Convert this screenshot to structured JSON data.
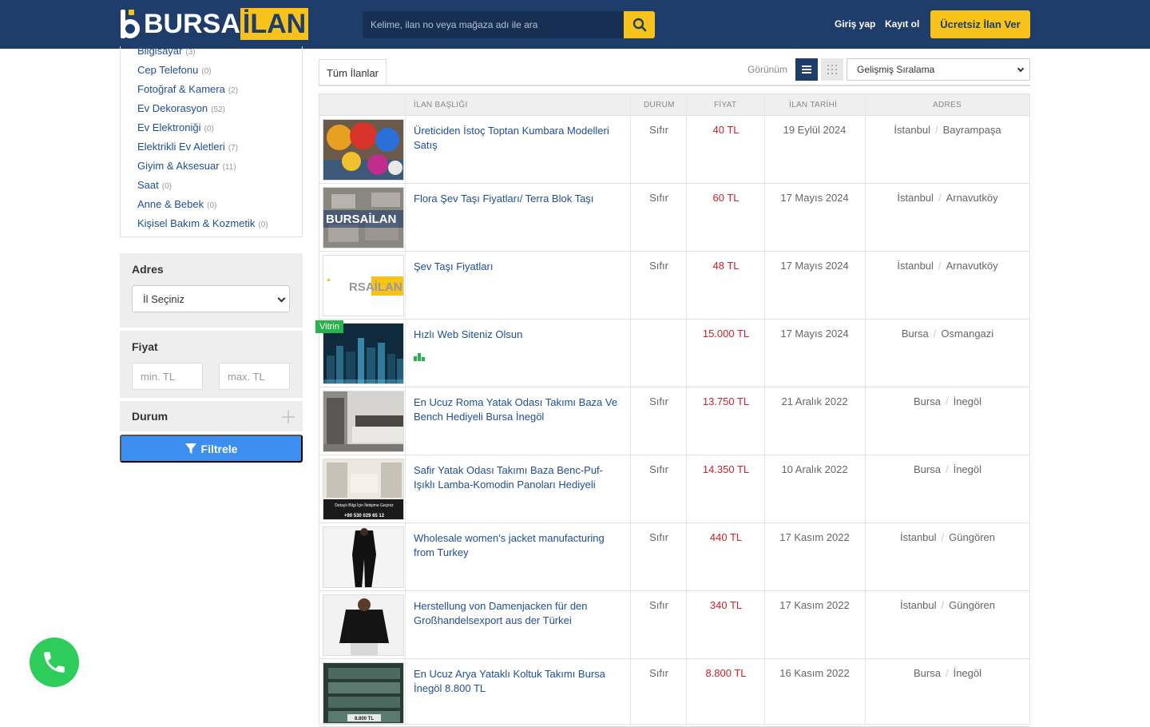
{
  "header": {
    "logo_text_1": "BURSA",
    "logo_text_2": "İLAN",
    "search_placeholder": "Kelime, ilan no veya mağaza adı ile ara",
    "login": "Giriş yap",
    "register": "Kayıt ol",
    "post_ad": "Ücretsiz İlan Ver"
  },
  "colors": {
    "brand": "#1f3d6b",
    "accent": "#f7c21a",
    "link": "#1f4e96",
    "price": "#d0202a",
    "filter": "#3c8ff0"
  },
  "categories": [
    {
      "label": "Bilgisayar",
      "count": "(3)"
    },
    {
      "label": "Cep Telefonu",
      "count": "(0)"
    },
    {
      "label": "Fotoğraf & Kamera",
      "count": "(2)"
    },
    {
      "label": "Ev Dekorasyon",
      "count": "(52)"
    },
    {
      "label": "Ev Elektroniği",
      "count": "(0)"
    },
    {
      "label": "Elektrikli Ev Aletleri",
      "count": "(7)"
    },
    {
      "label": "Giyim & Aksesuar",
      "count": "(11)"
    },
    {
      "label": "Saat",
      "count": "(0)"
    },
    {
      "label": "Anne & Bebek",
      "count": "(0)"
    },
    {
      "label": "Kişisel Bakım & Kozmetik",
      "count": "(0)"
    }
  ],
  "filters": {
    "address_title": "Adres",
    "city_select": "İl Seçiniz",
    "price_title": "Fiyat",
    "min_placeholder": "min. TL",
    "max_placeholder": "max. TL",
    "condition_title": "Durum",
    "filter_button": "Filtrele"
  },
  "main": {
    "tab_all": "Tüm İlanlar",
    "view_label": "Görünüm",
    "sort_selected": "Gelişmiş Sıralama",
    "columns": [
      "İLAN BAŞLIĞI",
      "DURUM",
      "FİYAT",
      "İLAN TARİHİ",
      "ADRES"
    ],
    "badge": "Vitrin",
    "rows": [
      {
        "title": "Üreticiden İstoç Toptan Kumbara Modelleri Satış",
        "condition": "Sıfır",
        "price": "40 TL",
        "date": "19 Eylül 2024",
        "city": "İstanbul",
        "district": "Bayrampaşa"
      },
      {
        "title": "Flora Şev Taşı Fiyatları/ Terra Blok Taşı",
        "condition": "Sıfır",
        "price": "60 TL",
        "date": "17 Mayıs 2024",
        "city": "İstanbul",
        "district": "Arnavutköy"
      },
      {
        "title": "Şev Taşı Fiyatları",
        "condition": "Sıfır",
        "price": "48 TL",
        "date": "17 Mayıs 2024",
        "city": "İstanbul",
        "district": "Arnavutköy"
      },
      {
        "title": "Hızlı Web Siteniz Olsun",
        "condition": "",
        "price": "15.000 TL",
        "date": "17 Mayıs 2024",
        "city": "Bursa",
        "district": "Osmangazi"
      },
      {
        "title": "En Ucuz Roma Yatak Odası Takımı Baza Ve Bench Hediyeli Bursa İnegöl",
        "condition": "Sıfır",
        "price": "13.750 TL",
        "date": "21 Aralık 2022",
        "city": "Bursa",
        "district": "İnegöl"
      },
      {
        "title": "Safir Yatak Odası Takımı Baza Benc-Puf-Işıklı Lamba-Komodin Panoları Hediyeli",
        "condition": "Sıfır",
        "price": "14.350 TL",
        "date": "10 Aralık 2022",
        "city": "Bursa",
        "district": "İnegöl"
      },
      {
        "title": "Wholesale women's jacket manufacturing from Turkey",
        "condition": "Sıfır",
        "price": "440 TL",
        "date": "17 Kasım 2022",
        "city": "İstanbul",
        "district": "Güngören"
      },
      {
        "title": "Herstellung von Damenjacken für den Großhandelsexport aus der Türkei",
        "condition": "Sıfır",
        "price": "340 TL",
        "date": "17 Kasım 2022",
        "city": "İstanbul",
        "district": "Güngören"
      },
      {
        "title": "En Ucuz Arya Yataklı Koltuk Takımı Bursa İnegöl 8.800 TL",
        "condition": "Sıfır",
        "price": "8.800 TL",
        "date": "16 Kasım 2022",
        "city": "Bursa",
        "district": "İnegöl"
      }
    ]
  },
  "thumbs": {
    "t2_text": "BURSAİLAN",
    "t3_text": "RSAİLAN",
    "t6_text_1": "Detaylı Bilgi İçin İletişime Geçiniz",
    "t6_text_2": "+90 530 029 65 12",
    "t9_text": "8.800 TL"
  }
}
